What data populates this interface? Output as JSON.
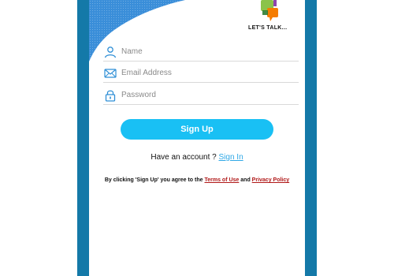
{
  "logo": {
    "text": "LET'S TALK..."
  },
  "form": {
    "name_placeholder": "Name",
    "email_placeholder": "Email Address",
    "password_placeholder": "Password"
  },
  "signup_button": "Sign Up",
  "account": {
    "prompt": "Have an account ? ",
    "signin_link": "Sign In"
  },
  "terms": {
    "prefix": "By clicking 'Sign Up' you agree to the ",
    "terms_link": "Terms of Use",
    "middle": " and ",
    "privacy_link": "Privacy Policy"
  },
  "colors": {
    "accent": "#19c0f4",
    "border": "#1479a8",
    "link": "#2fa8e6",
    "terms_link": "#b01818"
  },
  "icons": [
    "user-icon",
    "envelope-icon",
    "lock-icon",
    "chat-bubbles-logo"
  ]
}
